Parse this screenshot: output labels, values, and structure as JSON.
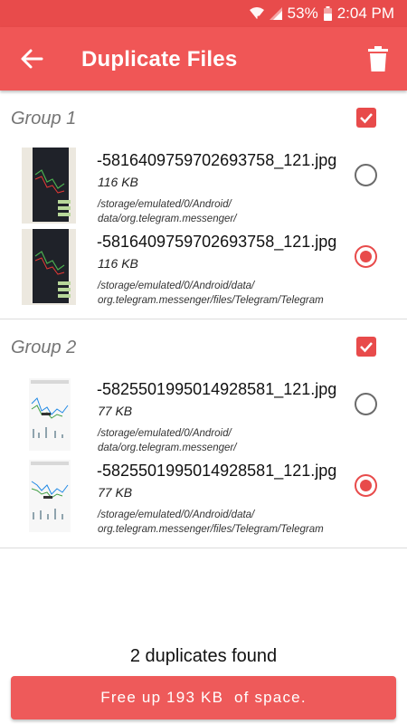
{
  "status_bar": {
    "battery": "53%",
    "time": "2:04 PM",
    "icons": [
      "wifi-icon",
      "signal-icon",
      "battery-icon"
    ]
  },
  "app_bar": {
    "title": "Duplicate Files",
    "back_icon": "arrow-left-icon",
    "delete_icon": "trash-icon"
  },
  "colors": {
    "status_bar": "#e84b4b",
    "app_bar": "#f05656",
    "accent": "#e84b4b",
    "button": "#ee5a5a"
  },
  "groups": [
    {
      "title": "Group 1",
      "checked": true,
      "files": [
        {
          "name": "-5816409759702693758_121.jpg",
          "size": "116 KB",
          "path_line1": "/storage/emulated/0/Android/",
          "path_line2": "data/org.telegram.messenger/",
          "selected": false,
          "thumbnail": "dark-trading-chart-thumbnail"
        },
        {
          "name": "-5816409759702693758_121.jpg",
          "size": "116 KB",
          "path_line1": "/storage/emulated/0/Android/data/",
          "path_line2": "org.telegram.messenger/files/Telegram/Telegram",
          "selected": true,
          "thumbnail": "dark-trading-chart-thumbnail"
        }
      ]
    },
    {
      "title": "Group 2",
      "checked": true,
      "files": [
        {
          "name": "-5825501995014928581_121.jpg",
          "size": "77 KB",
          "path_line1": "/storage/emulated/0/Android/",
          "path_line2": "data/org.telegram.messenger/",
          "selected": false,
          "thumbnail": "light-trading-chart-thumbnail"
        },
        {
          "name": "-5825501995014928581_121.jpg",
          "size": "77 KB",
          "path_line1": "/storage/emulated/0/Android/data/",
          "path_line2": "org.telegram.messenger/files/Telegram/Telegram",
          "selected": true,
          "thumbnail": "light-trading-chart-thumbnail"
        }
      ]
    }
  ],
  "summary": "2 duplicates found",
  "free_up_button": "Free up 193 KB  of space."
}
